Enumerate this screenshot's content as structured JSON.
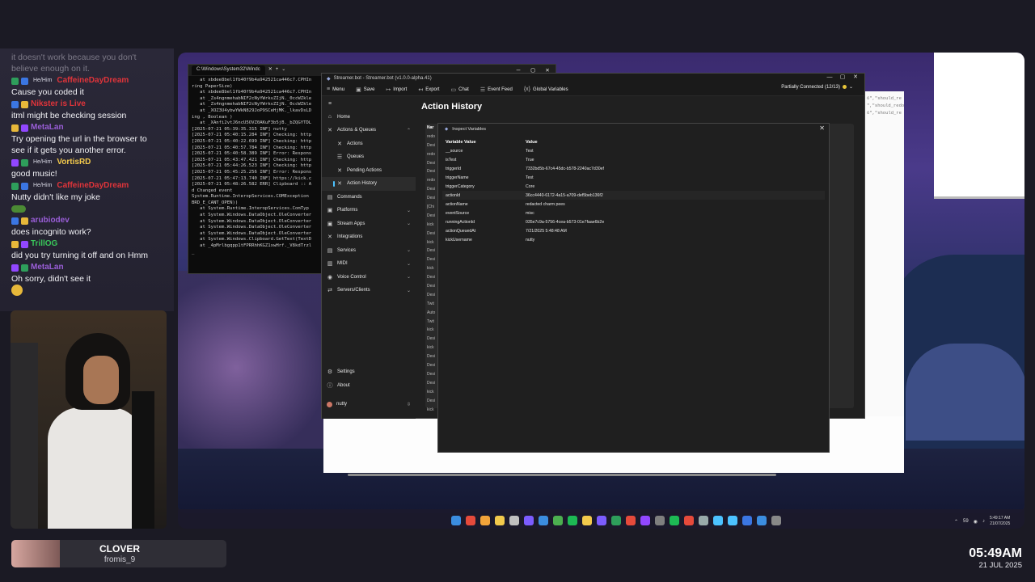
{
  "chat": {
    "messages": [
      {
        "user": "",
        "pronouns": "",
        "text": "it doesn't work because you don't believe enough on it.",
        "user_color": "#ffffff",
        "faded": true
      },
      {
        "user": "CaffeineDayDream",
        "pronouns": "He/Him",
        "text": "Cause you coded it",
        "user_color": "#e0343a"
      },
      {
        "user": "Nikster is Live",
        "pronouns": "",
        "text": "itml might be checking session",
        "user_color": "#e0343a"
      },
      {
        "user": "MetaLan",
        "pronouns": "",
        "text": "Try opening the url in the browser to see if it gets you another error.",
        "user_color": "#9a5ed8"
      },
      {
        "user": "VortisRD",
        "pronouns": "He/Him",
        "text": "good music!",
        "user_color": "#f2c94c"
      },
      {
        "user": "CaffeineDayDream",
        "pronouns": "He/Him",
        "text": "Nutty didn't like my joke",
        "user_color": "#e0343a"
      },
      {
        "user": "arubiodev",
        "pronouns": "",
        "text": "does incognito work?",
        "user_color": "#9a5ed8"
      },
      {
        "user": "TrillOG",
        "pronouns": "",
        "text": "did you try turning it off and on Hmm",
        "user_color": "#39c75a"
      },
      {
        "user": "MetaLan",
        "pronouns": "",
        "text": "Oh sorry, didn't see it",
        "user_color": "#9a5ed8"
      }
    ]
  },
  "nameplate": {
    "name": "CLOVER",
    "sub": "fromis_9"
  },
  "clock": {
    "time": "05:49AM",
    "date": "21 JUL 2025"
  },
  "terminal": {
    "title": "C:\\Windows\\System32\\Windc",
    "lines": [
      "   at xbdee8bel1fb40f9b4a942521ca446c7.CPHIn",
      "ring PaperSize)",
      "   at xbdee8bel1fb40f9b4a942521ca446c7.CPHIn",
      "   at _Zs4ngnmehabNIF2cNyYWrkvZIjN._0ccWZkle",
      "   at _Zs4ngnmehabNIF2cNyYWrkvZIjN._0ccWZkle",
      "   at _XOZ3U4ybwYWkN829JoP9SCeHjMK._lkavDsLD",
      "ing , Boolean )",
      "   at _XAnfi2vtJ6ncU5OVZ0AKuF3b5jB._bZQGYTDL",
      "[2025-07-21 05:39:35.315 INF] nutty",
      "[2025-07-21 05:40:15.284 INF] Checking: http",
      "[2025-07-21 05:40:22.699 INF] Checking: http",
      "[2025-07-21 05:40:57.784 INF] Checking: http",
      "[2025-07-21 05:40:58.389 INF] Error: Respons",
      "[2025-07-21 05:43:47.421 INF] Checking: http",
      "[2025-07-21 05:44:26.523 INF] Checking: http",
      "[2025-07-21 05:45:25.256 INF] Error: Respons",
      "[2025-07-21 05:47:13.740 INF] https://kick.c",
      "[2025-07-21 05:48:26.582 ERR] Clipboard :: A",
      "d Changed event",
      "System.Runtime.InteropServices.COMException",
      "BRD_E_CANT_OPEN))",
      "   at System.Runtime.InteropServices.ComTyp",
      "   at System.Windows.DataObject.OleConverter",
      "   at System.Windows.DataObject.OleConverter",
      "   at System.Windows.DataObject.OleConverter",
      "   at System.Windows.DataObject.OleConverter",
      "   at System.Windows.Clipboard.GetText(TextD",
      "   at _4pMrlbgqpp1tFPRRhhKGZ1xwHrf._V8kdTrzl",
      "_"
    ]
  },
  "streamerbot": {
    "window_title": "Streamer.bot - Streamer.bot (v1.0.0-alpha.41)",
    "toolbar": [
      "Menu",
      "Save",
      "Import",
      "Export",
      "Chat",
      "Event Feed",
      "Global Variables"
    ],
    "status": "Partially Connected (12/13)",
    "nav": [
      {
        "label": "Home",
        "sub": false,
        "icon": "⌂"
      },
      {
        "label": "Actions & Queues",
        "sub": false,
        "icon": "✕",
        "chev": "⌃"
      },
      {
        "label": "Actions",
        "sub": true,
        "icon": "✕"
      },
      {
        "label": "Queues",
        "sub": true,
        "icon": "☰"
      },
      {
        "label": "Pending Actions",
        "sub": true,
        "icon": "✕"
      },
      {
        "label": "Action History",
        "sub": true,
        "icon": "✕",
        "active": true
      },
      {
        "label": "Commands",
        "sub": false,
        "icon": "▤"
      },
      {
        "label": "Platforms",
        "sub": false,
        "icon": "▣",
        "chev": "⌄"
      },
      {
        "label": "Stream Apps",
        "sub": false,
        "icon": "▣",
        "chev": "⌄"
      },
      {
        "label": "Integrations",
        "sub": false,
        "icon": "✕"
      },
      {
        "label": "Services",
        "sub": false,
        "icon": "▤",
        "chev": "⌄"
      },
      {
        "label": "MIDI",
        "sub": false,
        "icon": "▥",
        "chev": "⌄"
      },
      {
        "label": "Voice Control",
        "sub": false,
        "icon": "◉",
        "chev": "⌄"
      },
      {
        "label": "Servers/Clients",
        "sub": false,
        "icon": "⇄",
        "chev": "⌄"
      }
    ],
    "bottom_nav": [
      {
        "label": "Settings",
        "icon": "⚙"
      },
      {
        "label": "About",
        "icon": "ⓘ"
      }
    ],
    "user": "nutty",
    "page_title": "Action History",
    "history_col": "Nar",
    "history_rows": [
      "redo",
      "Desi",
      "redo",
      "Desi",
      "Desi",
      "redo",
      "Desi",
      "Desi",
      "[Chi",
      "Desi",
      "kick",
      "Desi",
      "kick",
      "Desi",
      "Desi",
      "kick",
      "Desi",
      "Desi",
      "Desi",
      "Twit",
      "Auto",
      "Twit",
      "kick",
      "Desi",
      "kick",
      "Desi",
      "Desi",
      "Desi",
      "Desi",
      "kick",
      "Desi",
      "kick"
    ]
  },
  "dialog": {
    "title": "Inspect Variables",
    "columns": [
      "Variable Value",
      "Value"
    ],
    "rows": [
      [
        "__source",
        "Test"
      ],
      [
        "isTest",
        "True"
      ],
      [
        "triggerId",
        "7332bd5b-67c4-45dc-b578-2240ac7d30ef"
      ],
      [
        "triggerName",
        "Test"
      ],
      [
        "triggerCategory",
        "Core"
      ],
      [
        "actionId",
        "36cc4440-6172-4a15-a709-def5beb136f2"
      ],
      [
        "actionName",
        "redacted charm pees"
      ],
      [
        "eventSource",
        "misc"
      ],
      [
        "runningActionId",
        "035e7c9a-5756-4cea-b573-01e7faae6b2e"
      ],
      [
        "actionQueuedAt",
        "7/21/2025 5:48:48 AM"
      ],
      [
        "kickUsername",
        "nutty"
      ]
    ],
    "selected_row": 5
  },
  "browser_snippet": [
    "6\",\"should_re",
    "\",\"should_redo",
    "6\",\"should_re"
  ],
  "tray": {
    "num": "59",
    "time": "5:49:17 AM",
    "date": "21/07/2025"
  }
}
